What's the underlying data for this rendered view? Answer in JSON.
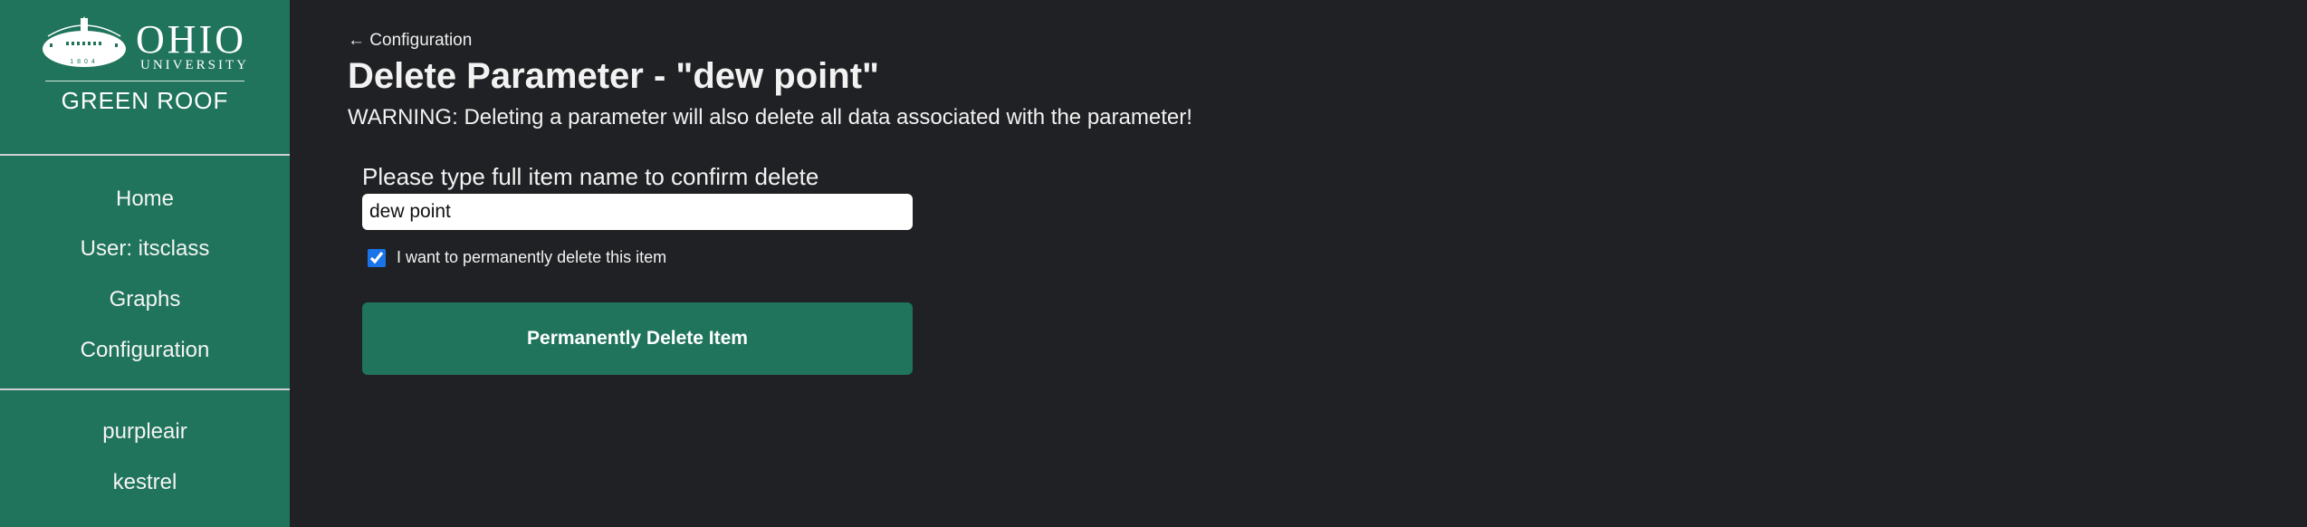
{
  "sidebar": {
    "logo": {
      "name": "OHIO",
      "sub": "UNIVERSITY",
      "year": "1804",
      "app": "GREEN ROOF"
    },
    "nav": [
      "Home",
      "User: itsclass",
      "Graphs",
      "Configuration"
    ],
    "devices": [
      "purpleair",
      "kestrel"
    ]
  },
  "main": {
    "back_link": "Configuration",
    "title": "Delete Parameter - \"dew point\"",
    "warning": "WARNING: Deleting a parameter will also delete all data associated with the parameter!",
    "confirm_label": "Please type full item name to confirm delete",
    "confirm_value": "dew point",
    "checkbox_label": "I want to permanently delete this item",
    "delete_button": "Permanently Delete Item"
  },
  "colors": {
    "accent": "#1f745b",
    "background": "#202124"
  }
}
